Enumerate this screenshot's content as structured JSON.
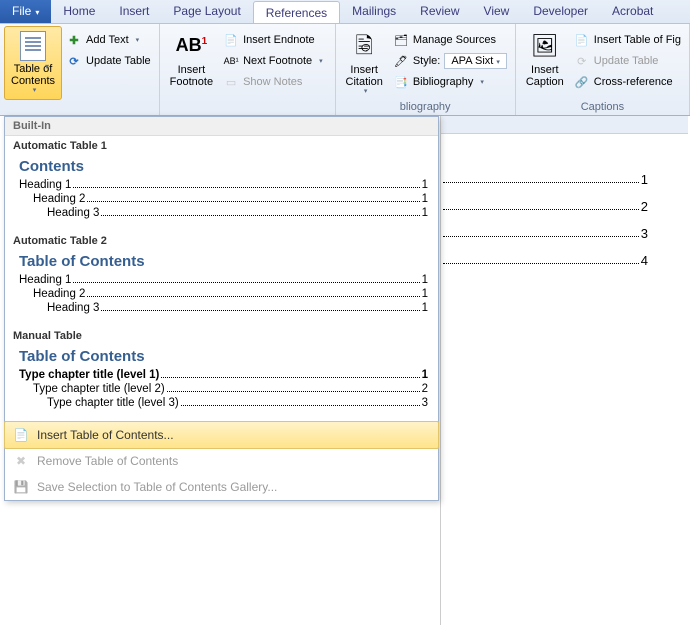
{
  "tabs": {
    "file": "File",
    "home": "Home",
    "insert": "Insert",
    "page_layout": "Page Layout",
    "references": "References",
    "mailings": "Mailings",
    "review": "Review",
    "view": "View",
    "developer": "Developer",
    "acrobat": "Acrobat"
  },
  "ribbon": {
    "toc": {
      "big": "Table of\nContents",
      "add_text": "Add Text",
      "update_table": "Update Table"
    },
    "footnotes": {
      "big": "Insert\nFootnote",
      "ab1": "AB",
      "insert_endnote": "Insert Endnote",
      "next_footnote": "Next Footnote",
      "show_notes": "Show Notes"
    },
    "citations": {
      "big": "Insert\nCitation",
      "manage_sources": "Manage Sources",
      "style_label": "Style:",
      "style_value": "APA Sixt",
      "bibliography": "Bibliography",
      "group": "bliography"
    },
    "captions": {
      "big": "Insert\nCaption",
      "insert_tof": "Insert Table of Fig",
      "update_table": "Update Table",
      "cross_ref": "Cross-reference",
      "group": "Captions"
    }
  },
  "dropdown": {
    "builtin": "Built-In",
    "auto1": {
      "head": "Automatic Table 1",
      "title": "Contents",
      "h1": "Heading 1",
      "h2": "Heading 2",
      "h3": "Heading 3",
      "pg": "1"
    },
    "auto2": {
      "head": "Automatic Table 2",
      "title": "Table of Contents",
      "h1": "Heading 1",
      "h2": "Heading 2",
      "h3": "Heading 3",
      "pg": "1"
    },
    "manual": {
      "head": "Manual Table",
      "title": "Table of Contents",
      "l1": "Type chapter title (level 1)",
      "l2": "Type chapter title (level 2)",
      "l3": "Type chapter title (level 3)",
      "p1": "1",
      "p2": "2",
      "p3": "3"
    },
    "actions": {
      "insert": "Insert Table of Contents...",
      "remove": "Remove Table of Contents",
      "save": "Save Selection to Table of Contents Gallery..."
    }
  },
  "doc": {
    "p1": "1",
    "p2": "2",
    "p3": "3",
    "p4": "4"
  }
}
